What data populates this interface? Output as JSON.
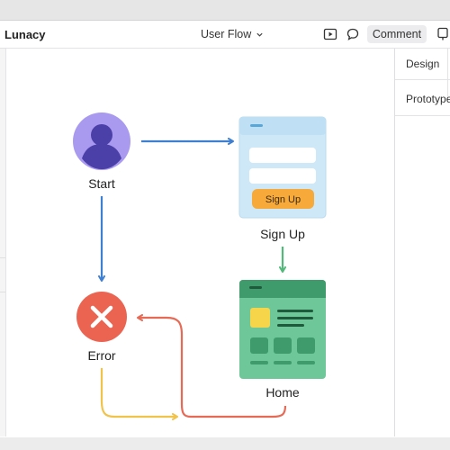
{
  "app": {
    "name": "Lunacy"
  },
  "document": {
    "title": "User Flow"
  },
  "toolbar": {
    "icons": [
      "play-icon",
      "comment-bubble-icon",
      "phone-icon"
    ],
    "comment_label": "Comment"
  },
  "right_panel": {
    "tabs": [
      {
        "label": "Design"
      },
      {
        "label": "Prototype"
      }
    ]
  },
  "flow": {
    "nodes": {
      "start": {
        "label": "Start",
        "icon": "user-avatar-icon",
        "color": "#a99af0"
      },
      "signup": {
        "label": "Sign Up",
        "button_label": "Sign Up",
        "color": "#cfe8f7",
        "button_color": "#f7aa3a"
      },
      "home": {
        "label": "Home",
        "color": "#6ec798"
      },
      "error": {
        "label": "Error",
        "icon": "close-icon",
        "color": "#eb6452"
      }
    },
    "colors": {
      "blue_arrow": "#3f7fd1",
      "green_arrow": "#53b97a",
      "red_arrow": "#e66a55",
      "yellow_arrow": "#f2c34a"
    }
  }
}
